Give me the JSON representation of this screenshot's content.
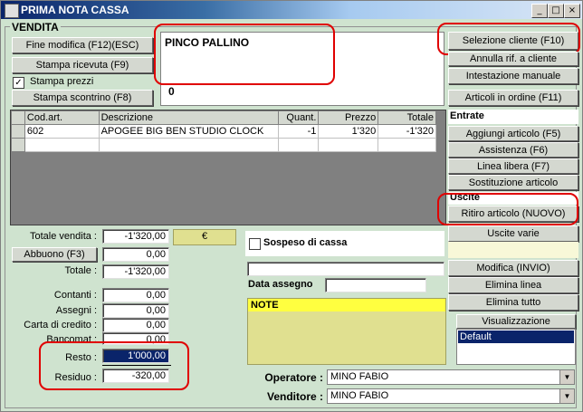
{
  "window": {
    "title": "PRIMA NOTA CASSA"
  },
  "group": {
    "title": "VENDITA"
  },
  "left_buttons": {
    "fine_modifica": "Fine modifica (F12)(ESC)",
    "stampa_ricevuta": "Stampa ricevuta (F9)",
    "stampa_prezzi": "Stampa prezzi",
    "stampa_scontrino": "Stampa scontrino (F8)"
  },
  "customer": {
    "name": "PINCO PALLINO",
    "code": "0"
  },
  "table": {
    "headers": [
      "Cod.art.",
      "Descrizione",
      "Quant.",
      "Prezzo",
      "Totale"
    ],
    "rows": [
      [
        "602",
        "APOGEE BIG BEN STUDIO CLOCK",
        "-1",
        "1'320",
        "-1'320"
      ]
    ]
  },
  "totals": {
    "totale_vendita_label": "Totale vendita :",
    "totale_vendita": "-1'320,00",
    "currency": "€",
    "abbuono_label": "Abbuono (F3)",
    "abbuono": "0,00",
    "totale_label": "Totale :",
    "totale": "-1'320,00",
    "contanti_label": "Contanti :",
    "contanti": "0,00",
    "assegni_label": "Assegni :",
    "assegni": "0,00",
    "carta_label": "Carta di credito :",
    "carta": "0,00",
    "bancomat_label": "Bancomat :",
    "bancomat": "0,00",
    "resto_label": "Resto :",
    "resto": "1'000,00",
    "residuo_label": "Residuo :",
    "residuo": "-320,00"
  },
  "middle": {
    "sospeso": "Sospeso di cassa",
    "data_assegno": "Data assegno",
    "note": "NOTE"
  },
  "operators": {
    "operatore_label": "Operatore :",
    "operatore": "MINO FABIO",
    "venditore_label": "Venditore :",
    "venditore": "MINO FABIO"
  },
  "right": {
    "selezione_cliente": "Selezione cliente (F10)",
    "annulla": "Annulla rif. a cliente",
    "intestazione": "Intestazione manuale",
    "articoli_ordine": "Articoli in ordine (F11)",
    "entrate": "Entrate",
    "aggiungi": "Aggiungi articolo (F5)",
    "assistenza": "Assistenza (F6)",
    "linea_libera": "Linea libera (F7)",
    "sostituzione": "Sostituzione articolo",
    "uscite": "Uscite",
    "ritiro": "Ritiro articolo (NUOVO)",
    "uscite_varie": "Uscite varie",
    "modifica": "Modifica (INVIO)",
    "elimina_linea": "Elimina linea",
    "elimina_tutto": "Elimina tutto",
    "visualizzazione": "Visualizzazione",
    "default": "Default"
  },
  "colors": {
    "background": "#cfe3cf",
    "highlight": "#e00000",
    "note_bg": "#e0e090",
    "note_header": "#ffff40",
    "selected": "#0a246a"
  }
}
